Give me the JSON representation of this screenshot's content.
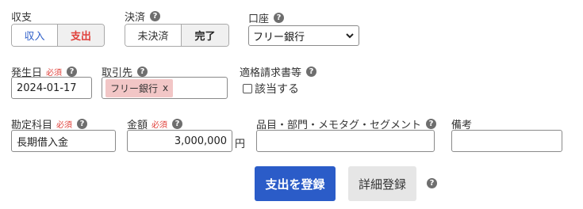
{
  "income_expense": {
    "label": "収支",
    "options": [
      "収入",
      "支出"
    ],
    "selected": "支出"
  },
  "settlement": {
    "label": "決済",
    "options": [
      "未決済",
      "完了"
    ],
    "selected": "完了",
    "help": "?"
  },
  "account": {
    "label": "口座",
    "value": "フリー銀行",
    "help": "?"
  },
  "date": {
    "label": "発生日",
    "required": "必須",
    "value": "2024-01-17",
    "help": "?"
  },
  "partner": {
    "label": "取引先",
    "tag": "フリー銀行",
    "tag_remove": "x",
    "help": "?"
  },
  "qualified_invoice": {
    "label": "適格請求書等",
    "checkbox_label": "該当する",
    "checked": false,
    "help": "?"
  },
  "account_item": {
    "label": "勘定科目",
    "required": "必須",
    "value": "長期借入金",
    "help": "?"
  },
  "amount": {
    "label": "金額",
    "required": "必須",
    "value": "3,000,000",
    "unit": "円",
    "help": "?"
  },
  "tags": {
    "label": "品目・部門・メモタグ・セグメント",
    "value": "",
    "help": "?"
  },
  "remarks": {
    "label": "備考",
    "value": ""
  },
  "actions": {
    "register_label": "支出を登録",
    "detail_label": "詳細登録",
    "help": "?"
  },
  "colors": {
    "primary": "#2b5cc8",
    "income_text": "#2f5fc9",
    "expense_text": "#e0403a",
    "required": "#e0403a",
    "tag_bg": "#f2c6c6"
  }
}
